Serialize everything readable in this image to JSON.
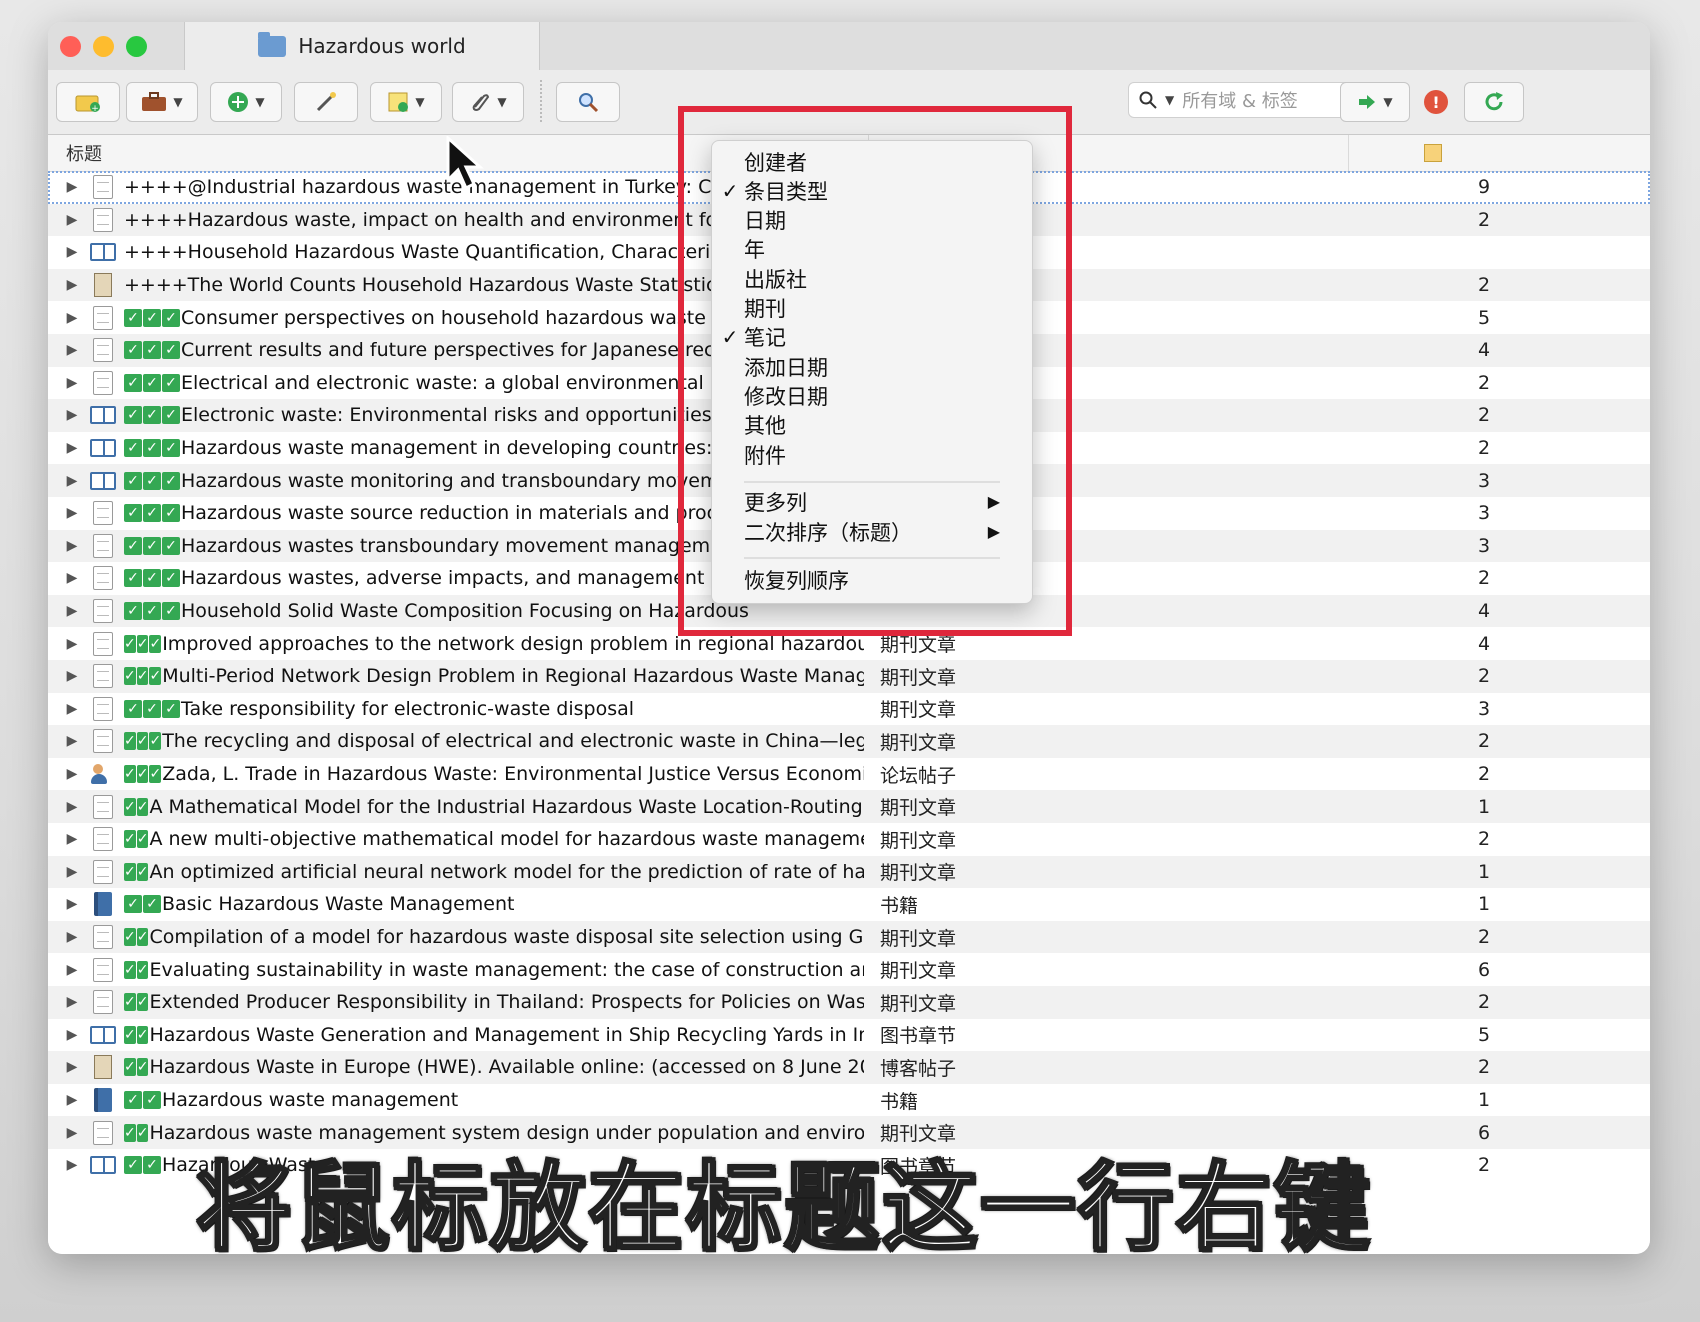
{
  "window": {
    "tab_title": "Hazardous world"
  },
  "toolbar": {
    "search_placeholder": "所有域 & 标签"
  },
  "columns": {
    "title": "标题",
    "item_type": "条目类型"
  },
  "rows": [
    {
      "icon": "document-icon",
      "marks": 0,
      "title": "++++@Industrial hazardous waste management in Turkey: Current",
      "type": "",
      "notes": "9",
      "selected": true
    },
    {
      "icon": "document-icon",
      "marks": 0,
      "title": "++++Hazardous waste, impact on health and environment for development",
      "type": "",
      "notes": "2"
    },
    {
      "icon": "book-section-icon",
      "marks": 0,
      "title": "++++Household Hazardous Waste Quantification, Characterization",
      "type": "",
      "notes": ""
    },
    {
      "icon": "webpage-icon",
      "marks": 0,
      "title": "++++The World Counts Household Hazardous Waste Statistics. The",
      "type": "",
      "notes": "2"
    },
    {
      "icon": "document-icon",
      "marks": 3,
      "title": "Consumer perspectives on household hazardous waste management",
      "type": "",
      "notes": "5"
    },
    {
      "icon": "document-icon",
      "marks": 3,
      "title": "Current results and future perspectives for Japanese recycling",
      "type": "",
      "notes": "4"
    },
    {
      "icon": "document-icon",
      "marks": 3,
      "title": "Electrical and electronic waste: a global environmental problem",
      "type": "",
      "notes": "2"
    },
    {
      "icon": "book-section-icon",
      "marks": 3,
      "title": "Electronic waste: Environmental risks and opportunities",
      "type": "",
      "notes": "2"
    },
    {
      "icon": "book-section-icon",
      "marks": 3,
      "title": "Hazardous waste management in developing countries: Current",
      "type": "",
      "notes": "2"
    },
    {
      "icon": "book-section-icon",
      "marks": 3,
      "title": "Hazardous waste monitoring and transboundary movement",
      "type": "",
      "notes": "3"
    },
    {
      "icon": "document-icon",
      "marks": 3,
      "title": "Hazardous waste source reduction in materials and processing",
      "type": "",
      "notes": "3"
    },
    {
      "icon": "document-icon",
      "marks": 3,
      "title": "Hazardous wastes transboundary movement management: a",
      "type": "",
      "notes": "3"
    },
    {
      "icon": "document-icon",
      "marks": 3,
      "title": "Hazardous wastes, adverse impacts, and management strategies",
      "type": "",
      "notes": "2"
    },
    {
      "icon": "document-icon",
      "marks": 3,
      "title": "Household Solid Waste Composition Focusing on Hazardous",
      "type": "",
      "notes": "4"
    },
    {
      "icon": "document-icon",
      "marks": 3,
      "title": "Improved approaches to the network design problem in regional hazardous...",
      "type": "期刊文章",
      "notes": "4"
    },
    {
      "icon": "document-icon",
      "marks": 3,
      "title": "Multi-Period Network Design Problem in Regional Hazardous Waste Manag...",
      "type": "期刊文章",
      "notes": "2"
    },
    {
      "icon": "document-icon",
      "marks": 3,
      "title": "Take responsibility for electronic-waste disposal",
      "type": "期刊文章",
      "notes": "3"
    },
    {
      "icon": "document-icon",
      "marks": 3,
      "title": "The recycling and disposal of electrical and electronic waste in China—legis...",
      "type": "期刊文章",
      "notes": "2"
    },
    {
      "icon": "forum-post-icon",
      "marks": 3,
      "title": "Zada, L. Trade in Hazardous Waste: Environmental Justice Versus Economic ...",
      "type": "论坛帖子",
      "notes": "2"
    },
    {
      "icon": "document-icon",
      "marks": 2,
      "title": "A Mathematical Model for the Industrial Hazardous Waste Location-Routing P...",
      "type": "期刊文章",
      "notes": "1"
    },
    {
      "icon": "document-icon",
      "marks": 2,
      "title": "A new multi-objective mathematical model for hazardous waste management...",
      "type": "期刊文章",
      "notes": "2"
    },
    {
      "icon": "document-icon",
      "marks": 2,
      "title": "An optimized artificial neural network model for the prediction of rate of haz...",
      "type": "期刊文章",
      "notes": "1"
    },
    {
      "icon": "book-icon",
      "marks": 2,
      "title": "Basic Hazardous Waste Management",
      "type": "书籍",
      "notes": "1"
    },
    {
      "icon": "document-icon",
      "marks": 2,
      "title": "Compilation of a model for hazardous waste disposal site selection using GIS...",
      "type": "期刊文章",
      "notes": "2"
    },
    {
      "icon": "document-icon",
      "marks": 2,
      "title": "Evaluating sustainability in waste management: the case of construction and ...",
      "type": "期刊文章",
      "notes": "6"
    },
    {
      "icon": "document-icon",
      "marks": 2,
      "title": "Extended Producer Responsibility in Thailand: Prospects for Policies on Waste...",
      "type": "期刊文章",
      "notes": "2"
    },
    {
      "icon": "book-section-icon",
      "marks": 2,
      "title": "Hazardous Waste Generation and Management in Ship Recycling Yards in Indi...",
      "type": "图书章节",
      "notes": "5"
    },
    {
      "icon": "webpage-icon",
      "marks": 2,
      "title": "Hazardous Waste in Europe (HWE). Available online: (accessed on 8 June 2020).",
      "type": "博客帖子",
      "notes": "2"
    },
    {
      "icon": "book-icon",
      "marks": 2,
      "title": "Hazardous waste management",
      "type": "书籍",
      "notes": "1"
    },
    {
      "icon": "document-icon",
      "marks": 2,
      "title": "Hazardous waste management system design under population and environ...",
      "type": "期刊文章",
      "notes": "6"
    },
    {
      "icon": "book-section-icon",
      "marks": 2,
      "title": "Hazardous Waste",
      "type": "图书章节",
      "notes": "2"
    }
  ],
  "context_menu": {
    "items": [
      {
        "label": "创建者",
        "checked": false
      },
      {
        "label": "条目类型",
        "checked": true
      },
      {
        "label": "日期",
        "checked": false
      },
      {
        "label": "年",
        "checked": false
      },
      {
        "label": "出版社",
        "checked": false
      },
      {
        "label": "期刊",
        "checked": false
      },
      {
        "label": "笔记",
        "checked": true
      },
      {
        "label": "添加日期",
        "checked": false
      },
      {
        "label": "修改日期",
        "checked": false
      },
      {
        "label": "其他",
        "checked": false
      },
      {
        "label": "附件",
        "checked": false
      }
    ],
    "more_columns": "更多列",
    "secondary_sort": "二次排序（标题）",
    "restore_order": "恢复列顺序"
  },
  "subtitle": "将鼠标放在标题这一行右键",
  "colors": {
    "highlight_box": "#e0283c",
    "check_green": "#34a853"
  }
}
